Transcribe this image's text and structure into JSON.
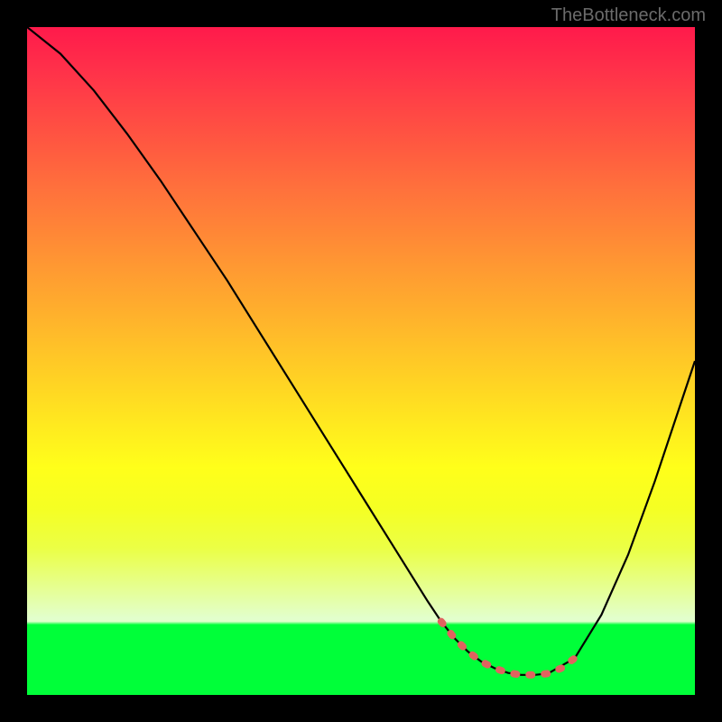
{
  "attribution": "TheBottleneck.com",
  "chart_data": {
    "type": "line",
    "title": "",
    "xlabel": "",
    "ylabel": "",
    "xlim": [
      0,
      100
    ],
    "ylim": [
      0,
      100
    ],
    "series": [
      {
        "name": "bottleneck-curve",
        "color": "#000000",
        "x": [
          0,
          5,
          10,
          15,
          20,
          25,
          30,
          35,
          40,
          45,
          50,
          55,
          60,
          62,
          64,
          66,
          68,
          70,
          72,
          74,
          76,
          78,
          82,
          86,
          90,
          94,
          98,
          100
        ],
        "y": [
          100,
          96,
          90.5,
          84,
          77,
          69.5,
          62,
          54,
          46,
          38,
          30,
          22,
          14,
          11,
          8.5,
          6.5,
          5,
          4,
          3.3,
          3,
          3,
          3.2,
          5.5,
          12,
          21,
          32,
          44,
          50
        ]
      },
      {
        "name": "highlight-segment",
        "color": "#e0635f",
        "x": [
          62,
          64,
          66,
          68,
          70,
          72,
          74,
          76,
          78,
          80,
          82
        ],
        "y": [
          11,
          8.5,
          6.5,
          5,
          4,
          3.3,
          3,
          3,
          3.2,
          4,
          5.5
        ]
      }
    ],
    "gradient_stops": [
      {
        "pos": 0,
        "color": "#ff1a4b"
      },
      {
        "pos": 50,
        "color": "#ffc228"
      },
      {
        "pos": 70,
        "color": "#ffff1a"
      },
      {
        "pos": 89,
        "color": "#e2ffcc"
      },
      {
        "pos": 100,
        "color": "#00ff39"
      }
    ]
  }
}
